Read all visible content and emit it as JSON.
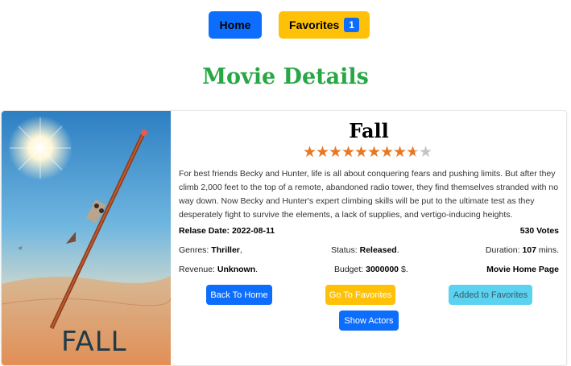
{
  "nav": {
    "home_label": "Home",
    "favorites_label": "Favorites",
    "favorites_count": "1"
  },
  "page_title": "Movie Details",
  "movie": {
    "title": "Fall",
    "poster_text": "FALL",
    "rating_stars": 8.7,
    "rating_max": 10,
    "overview": "For best friends Becky and Hunter, life is all about conquering fears and pushing limits. But after they climb 2,000 feet to the top of a remote, abandoned radio tower, they find themselves stranded with no way down. Now Becky and Hunter's expert climbing skills will be put to the ultimate test as they desperately fight to survive the elements, a lack of supplies, and vertigo-inducing heights.",
    "release_label": "Relase Date:",
    "release_date": "2022-08-11",
    "votes": "530 Votes",
    "genres_label": "Genres:",
    "genres": "Thriller",
    "genres_suffix": ",",
    "status_label": "Status:",
    "status": "Released",
    "status_suffix": ".",
    "duration_label": "Duration:",
    "duration": "107",
    "duration_suffix": "mins.",
    "revenue_label": "Revenue:",
    "revenue": "Unknown",
    "revenue_suffix": ".",
    "budget_label": "Budget:",
    "budget": "3000000",
    "budget_suffix": "$.",
    "home_page": "Movie Home Page"
  },
  "actions": {
    "back_label": "Back To Home",
    "to_favorites_label": "Go To Favorites",
    "added_label": "Added to Favorites",
    "actors_label": "Show Actors"
  },
  "colors": {
    "primary": "#0d6efd",
    "warning": "#ffc107",
    "info": "#5ad2f0",
    "title_green": "#28a745",
    "star_filled": "#e87722",
    "star_empty": "#c4c4c4"
  }
}
